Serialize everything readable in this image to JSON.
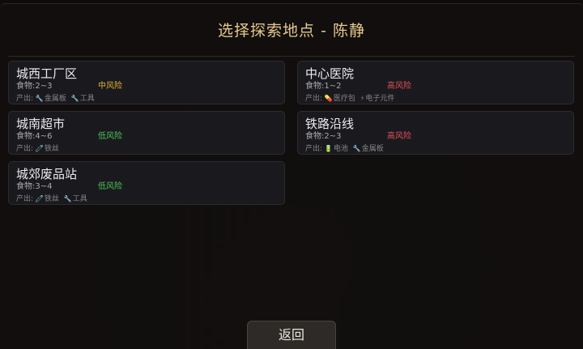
{
  "title": "选择探索地点 - 陈静",
  "labels": {
    "food_prefix": "食物:",
    "output_prefix": "产出:"
  },
  "colors": {
    "title": "#e6c98e",
    "risk_medium": "#e0b33a",
    "risk_low": "#4fc25a",
    "risk_high": "#e0505a"
  },
  "locations": [
    {
      "name": "城西工厂区",
      "food": "2~3",
      "risk": "中风险",
      "risk_level": "medium",
      "outputs": [
        {
          "icon": "wrench-icon",
          "glyph": "🔧",
          "label": "金属板"
        },
        {
          "icon": "wrench-icon",
          "glyph": "🔧",
          "label": "工具"
        }
      ]
    },
    {
      "name": "中心医院",
      "food": "1~2",
      "risk": "高风险",
      "risk_level": "high",
      "outputs": [
        {
          "icon": "pill-icon",
          "glyph": "💊",
          "label": "医疗包"
        },
        {
          "icon": "lightning-icon",
          "glyph": "⚡",
          "label": "电子元件"
        }
      ]
    },
    {
      "name": "城南超市",
      "food": "4~6",
      "risk": "低风险",
      "risk_level": "low",
      "outputs": [
        {
          "icon": "wire-icon",
          "glyph": "🧷",
          "label": "铁丝"
        }
      ]
    },
    {
      "name": "铁路沿线",
      "food": "2~3",
      "risk": "高风险",
      "risk_level": "high",
      "outputs": [
        {
          "icon": "battery-icon",
          "glyph": "🔋",
          "label": "电池"
        },
        {
          "icon": "wrench-icon",
          "glyph": "🔧",
          "label": "金属板"
        }
      ]
    },
    {
      "name": "城郊废品站",
      "food": "3~4",
      "risk": "低风险",
      "risk_level": "low",
      "outputs": [
        {
          "icon": "wire-icon",
          "glyph": "🧷",
          "label": "铁丝"
        },
        {
          "icon": "wrench-icon",
          "glyph": "🔧",
          "label": "工具"
        }
      ]
    }
  ],
  "back_button": "返回"
}
